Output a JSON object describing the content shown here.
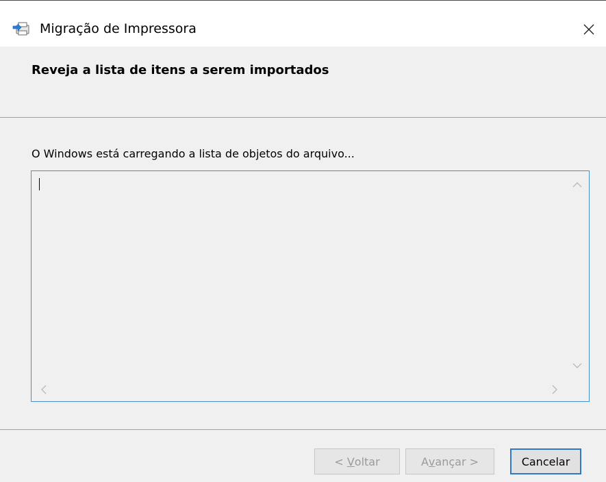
{
  "window": {
    "title": "Migração de Impressora",
    "icon": "printer-migration-icon"
  },
  "header": {
    "heading": "Reveja a lista de itens a serem importados"
  },
  "body": {
    "status_text": "O Windows está carregando a lista de objetos do arquivo..."
  },
  "buttons": {
    "back_prefix": "< ",
    "back_accel": "V",
    "back_rest": "oltar",
    "next_prefix": "A",
    "next_accel": "v",
    "next_rest": "ançar >",
    "cancel_label": "Cancelar"
  },
  "colors": {
    "accent": "#2f77c9",
    "listbox_border": "#4a90c8",
    "dialog_bg": "#f0f0f0",
    "disabled_text": "#9a9a9a"
  }
}
